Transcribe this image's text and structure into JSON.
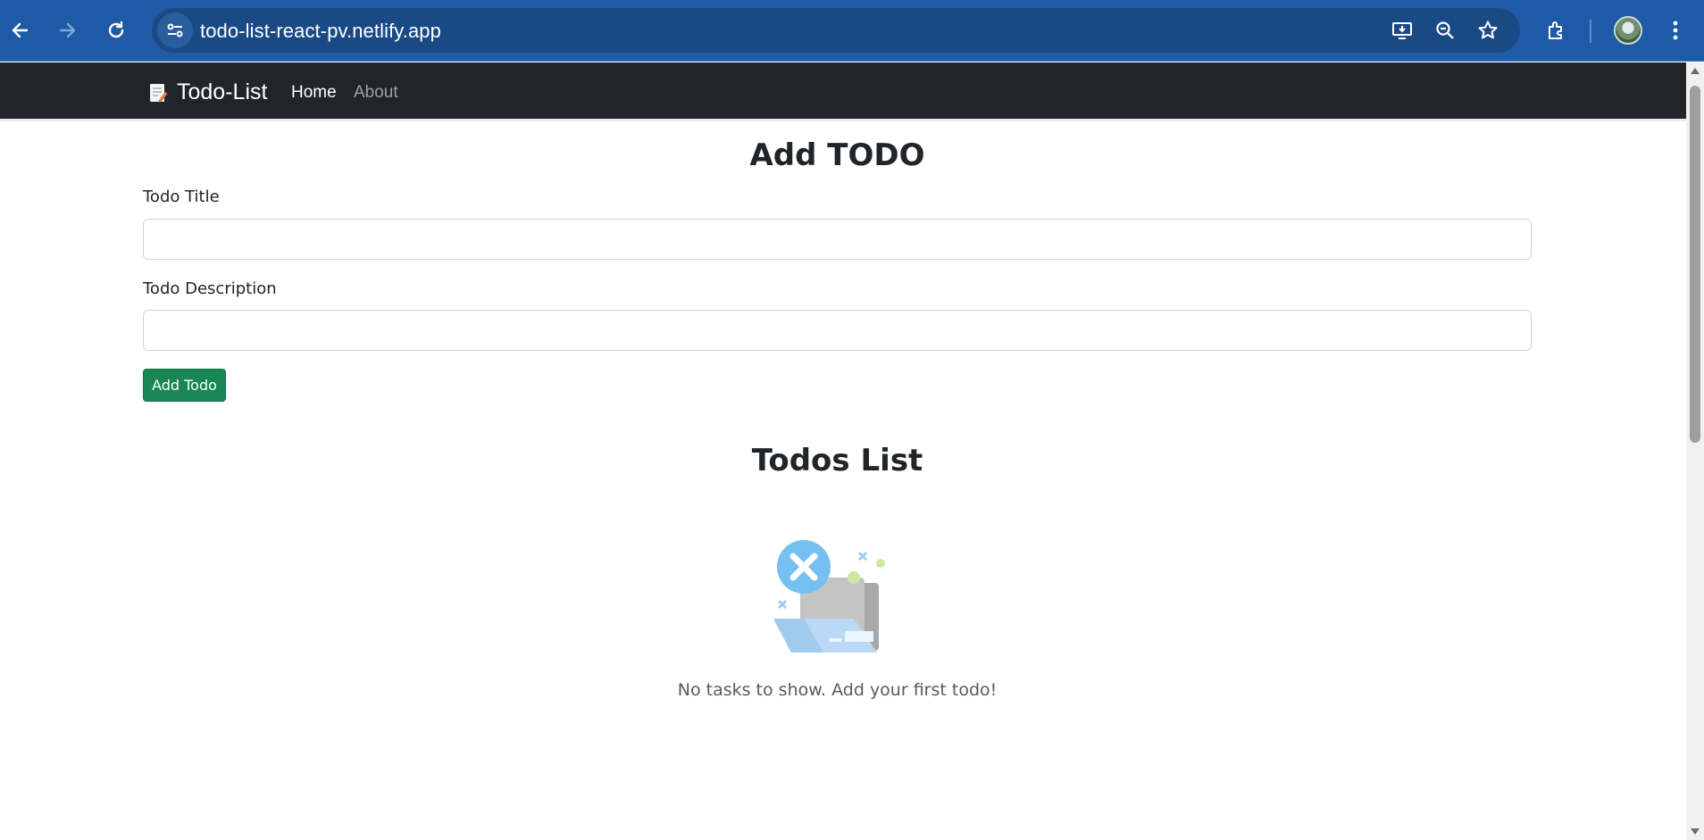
{
  "browser": {
    "url": "todo-list-react-pv.netlify.app",
    "icons": [
      "back-icon",
      "forward-icon",
      "reload-icon",
      "site-info-icon",
      "install-app-icon",
      "zoom-icon",
      "bookmark-star-icon",
      "extensions-icon",
      "profile-avatar",
      "menu-icon"
    ]
  },
  "navbar": {
    "brand": "Todo-List",
    "links": [
      "Home",
      "About"
    ],
    "active": "Home"
  },
  "form": {
    "heading": "Add TODO",
    "title_label": "Todo Title",
    "title_value": "",
    "desc_label": "Todo Description",
    "desc_value": "",
    "submit_label": "Add Todo"
  },
  "list": {
    "heading": "Todos List",
    "empty_message": "No tasks to show. Add your first todo!"
  },
  "colors": {
    "chrome": "#1f5aa6",
    "navbar": "#212529",
    "success": "#198754"
  }
}
